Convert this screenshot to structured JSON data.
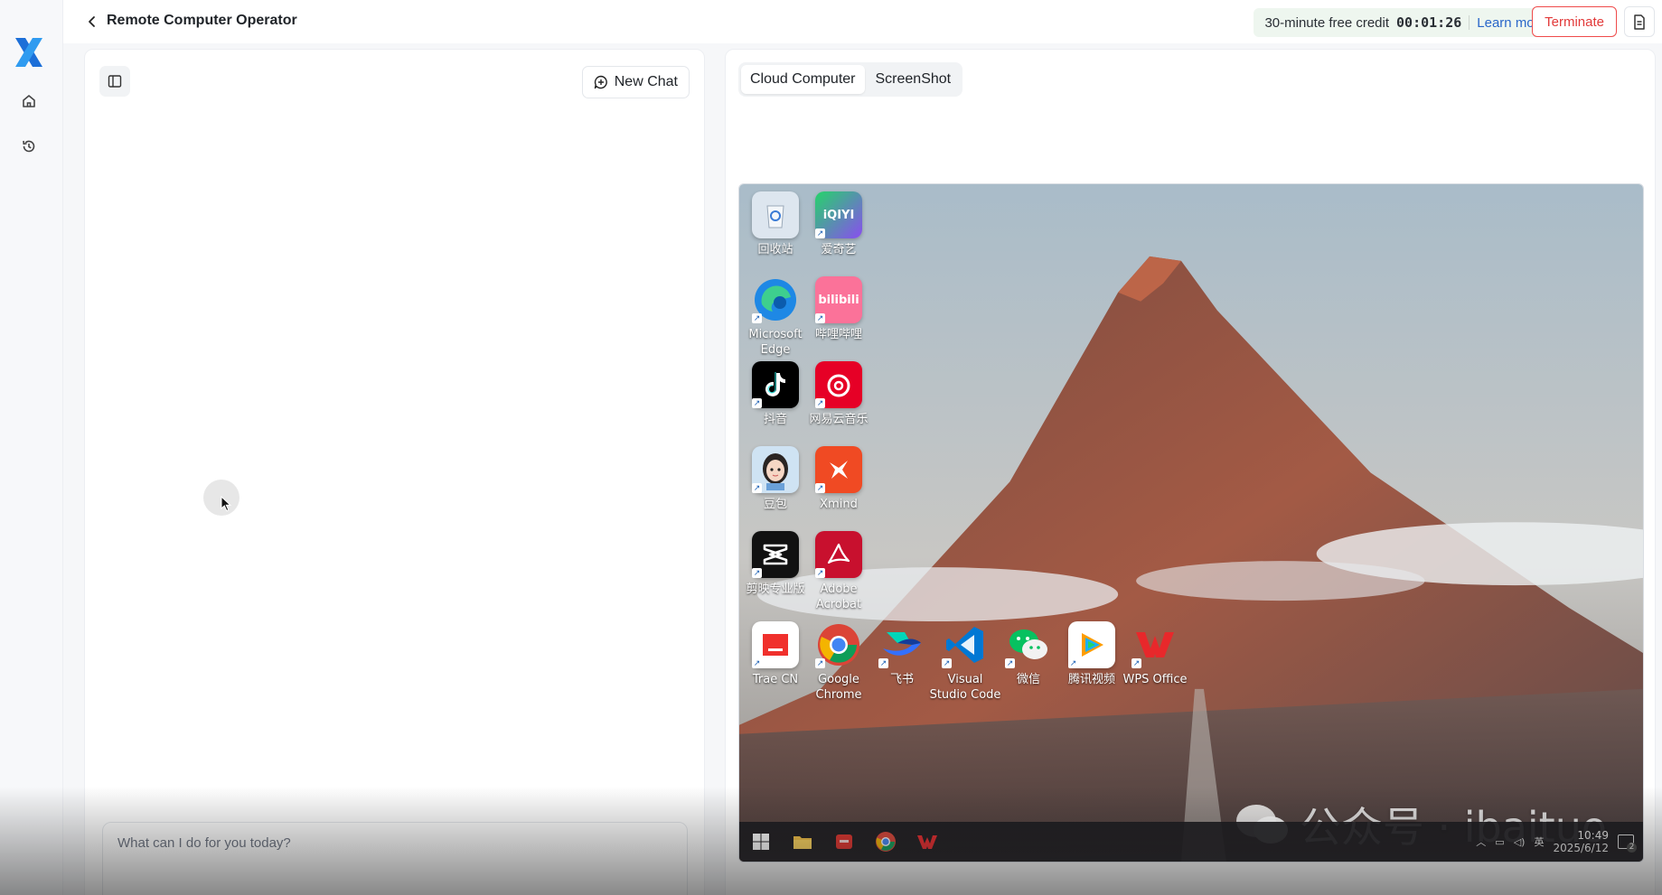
{
  "window": {
    "title": "Remote Computer Operator"
  },
  "credit": {
    "label": "30-minute free credit",
    "timer": "00:01:26",
    "learn_more": "Learn more"
  },
  "actions": {
    "terminate": "Terminate"
  },
  "chat": {
    "new_chat": "New Chat",
    "input_placeholder": "What can I do for you today?"
  },
  "tabs": [
    {
      "label": "Cloud Computer",
      "active": true
    },
    {
      "label": "ScreenShot",
      "active": false
    }
  ],
  "desktop": {
    "icons": [
      {
        "label": "回收站",
        "icon": "recycle-bin-icon",
        "color": "#e8eef5"
      },
      {
        "label": "爱奇艺",
        "icon": "iqiyi-icon",
        "color": "#2ecc71"
      },
      {
        "label": "Microsoft Edge",
        "icon": "edge-icon",
        "color": "#1e88e5"
      },
      {
        "label": "哔哩哔哩",
        "icon": "bilibili-icon",
        "color": "#fb7299"
      },
      {
        "label": "抖音",
        "icon": "douyin-icon",
        "color": "#000000"
      },
      {
        "label": "网易云音乐",
        "icon": "netease-music-icon",
        "color": "#e60026"
      },
      {
        "label": "豆包",
        "icon": "doubao-icon",
        "color": "#cfe3f3"
      },
      {
        "label": "Xmind",
        "icon": "xmind-icon",
        "color": "#f04a23"
      },
      {
        "label": "剪映专业版",
        "icon": "capcut-icon",
        "color": "#111111"
      },
      {
        "label": "Adobe Acrobat",
        "icon": "acrobat-icon",
        "color": "#c8102e"
      },
      {
        "label": "Trae CN",
        "icon": "trae-icon",
        "color": "#ffffff"
      },
      {
        "label": "Google Chrome",
        "icon": "chrome-icon",
        "color": "#ffffff"
      },
      {
        "label": "飞书",
        "icon": "feishu-icon",
        "color": "#3370ff"
      },
      {
        "label": "Visual Studio Code",
        "icon": "vscode-icon",
        "color": "#0078d4"
      },
      {
        "label": "微信",
        "icon": "wechat-icon",
        "color": "#07c160"
      },
      {
        "label": "腾讯视频",
        "icon": "tencent-video-icon",
        "color": "#ffffff"
      },
      {
        "label": "WPS Office",
        "icon": "wps-icon",
        "color": "#e8282b"
      }
    ],
    "clock_time": "10:49",
    "clock_date": "2025/6/12",
    "ime": "英",
    "notification_count": "2"
  },
  "watermark": {
    "text": "公众号 · ibaituo"
  }
}
